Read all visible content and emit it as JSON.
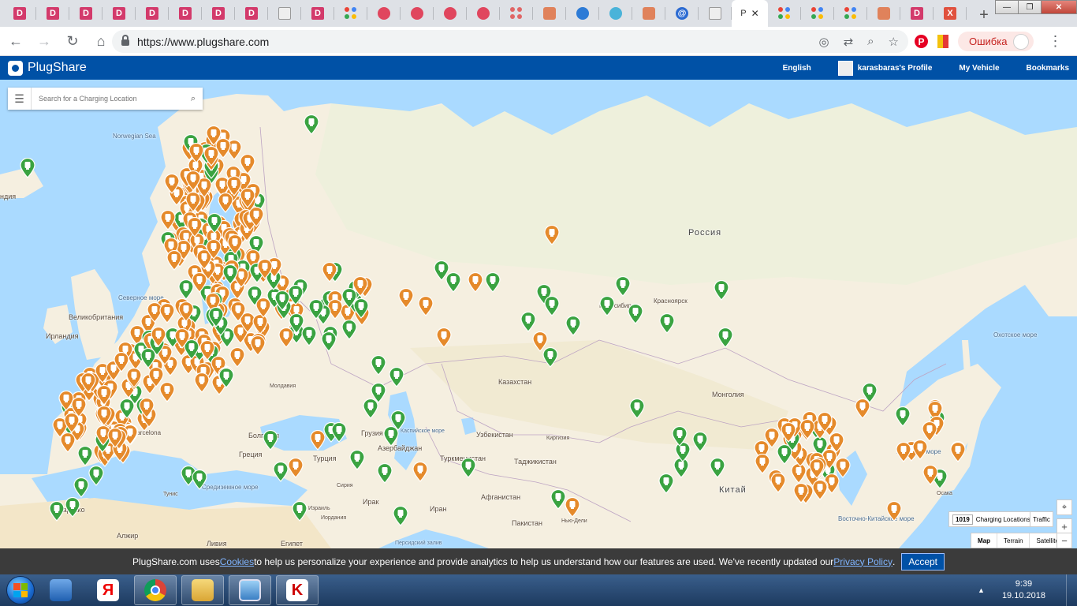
{
  "browser": {
    "tabs": [
      {
        "icon": "d",
        "label": "D"
      },
      {
        "icon": "d",
        "label": "D"
      },
      {
        "icon": "d",
        "label": "D"
      },
      {
        "icon": "d",
        "label": "D"
      },
      {
        "icon": "d",
        "label": "D"
      },
      {
        "icon": "d",
        "label": "D"
      },
      {
        "icon": "d",
        "label": "D"
      },
      {
        "icon": "d",
        "label": "D"
      },
      {
        "icon": "glyph",
        "label": ""
      },
      {
        "icon": "d",
        "label": "D"
      },
      {
        "icon": "dots",
        "label": ""
      },
      {
        "icon": "round-red",
        "label": ""
      },
      {
        "icon": "round-red",
        "label": ""
      },
      {
        "icon": "round-red",
        "label": ""
      },
      {
        "icon": "round-red",
        "label": ""
      },
      {
        "icon": "dots-red",
        "label": ""
      },
      {
        "icon": "car",
        "label": ""
      },
      {
        "icon": "round-blue",
        "label": ""
      },
      {
        "icon": "round-teal",
        "label": ""
      },
      {
        "icon": "car",
        "label": ""
      },
      {
        "icon": "at",
        "label": "@"
      },
      {
        "icon": "glyph",
        "label": ""
      }
    ],
    "active_tab": {
      "title": "P",
      "close": "✕"
    },
    "after_tabs": [
      {
        "icon": "dots",
        "label": ""
      },
      {
        "icon": "dots",
        "label": ""
      },
      {
        "icon": "dots",
        "label": ""
      },
      {
        "icon": "car",
        "label": ""
      },
      {
        "icon": "d",
        "label": "D"
      },
      {
        "icon": "x",
        "label": "X"
      }
    ],
    "new_tab": "+",
    "window_controls": {
      "minimize": "—",
      "maximize": "❐",
      "close": "✕"
    },
    "url": "https://www.plugshare.com",
    "error_label": "Ошибка",
    "colors": {
      "tab_d": "#d33a6b",
      "tab_x": "#e0513e",
      "pinterest": "#e60023"
    }
  },
  "app": {
    "brand": "PlugShare",
    "nav": {
      "language": "English",
      "profile": "karasbaras's Profile",
      "vehicle": "My Vehicle",
      "bookmarks": "Bookmarks"
    },
    "search": {
      "placeholder": "Search for a Charging Location"
    },
    "count": {
      "number": "1019",
      "label": "Charging Locations"
    },
    "traffic": "Traffic",
    "map_types": [
      "Map",
      "Terrain",
      "Satellite"
    ],
    "zoom_in": "+",
    "zoom_out": "−",
    "colors": {
      "brand_blue": "#0051a6",
      "pin_green": "#3aa341",
      "pin_orange": "#e58a2b"
    }
  },
  "map_labels": {
    "russia": "Россия",
    "norwegian_sea": "Norwegian Sea",
    "kazakhstan": "Казахстан",
    "mongolia": "Монголия",
    "china": "Китай",
    "uzbekistan": "Узбекистан",
    "turkmenistan": "Туркменистан",
    "tajikistan": "Таджикистан",
    "kyrgyzstan": "Киргизия",
    "afghanistan": "Афганистан",
    "pakistan": "Пакистан",
    "iran": "Иран",
    "iraq": "Ирак",
    "syria": "Сирия",
    "turkey": "Турция",
    "georgia": "Грузия",
    "azerbaijan": "Азербайджан",
    "ireland": "Ирландия",
    "britain": "Великобритания",
    "egypt": "Египет",
    "libya": "Ливия",
    "algeria": "Алжир",
    "morocco": "Марокко",
    "tunisia": "Тунис",
    "moldova": "Молдавия",
    "caspian": "Каспийское море",
    "north_sea": "Северное море",
    "mediterranean": "Средиземное море",
    "japan_sea": "Японское море",
    "okhotsk": "Охотское море",
    "east_china_sea": "Восточно-Китайское море",
    "persian_gulf": "Персидский залив",
    "novosibirsk": "Новосибирск",
    "krasnoyarsk": "Красноярск",
    "new_delhi": "Нью-Дели",
    "osaka": "Осака",
    "jordan": "Иордания",
    "israel": "Израиль",
    "barcelona": "Barcelona",
    "bulgaria": "Болгария",
    "greece": "Греция",
    "iceland": "ндия"
  },
  "cookie": {
    "pre": "PlugShare.com uses ",
    "cookies_link": "Cookies",
    "mid": " to help us personalize your experience and provide analytics to help us understand how our features are used. We've recently updated our ",
    "privacy_link": "Privacy Policy",
    "post": ".",
    "accept": "Accept"
  },
  "taskbar": {
    "time": "9:39",
    "date": "19.10.2018",
    "tray_arrow": "▲"
  }
}
